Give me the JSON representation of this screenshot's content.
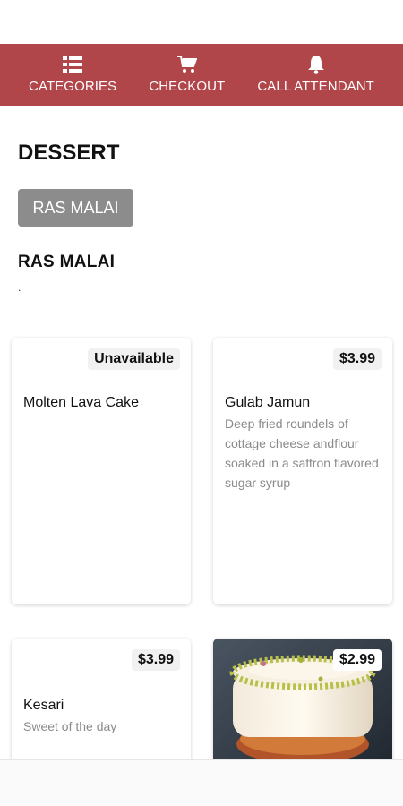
{
  "nav": {
    "items": [
      {
        "label": "CATEGORIES",
        "icon": "grid-list-icon"
      },
      {
        "label": "CHECKOUT",
        "icon": "cart-icon"
      },
      {
        "label": "CALL ATTENDANT",
        "icon": "bell-icon"
      }
    ],
    "background": "#b0454a"
  },
  "section": {
    "title": "DESSERT"
  },
  "filter": {
    "chip_label": "RAS MALAI"
  },
  "subcategory": {
    "title": "RAS MALAI",
    "note": "."
  },
  "items": [
    {
      "name": "Molten Lava Cake",
      "badge": "Unavailable",
      "description": ""
    },
    {
      "name": "Gulab Jamun",
      "badge": "$3.99",
      "description": "Deep fried roundels of cottage cheese andflour soaked in a saffron flavored sugar syrup"
    },
    {
      "name": "Kesari",
      "badge": "$3.99",
      "description": "Sweet of the day"
    },
    {
      "name": "",
      "badge": "$2.99",
      "description": "",
      "image": "pistachio-rasmalai-cake-photo"
    }
  ]
}
